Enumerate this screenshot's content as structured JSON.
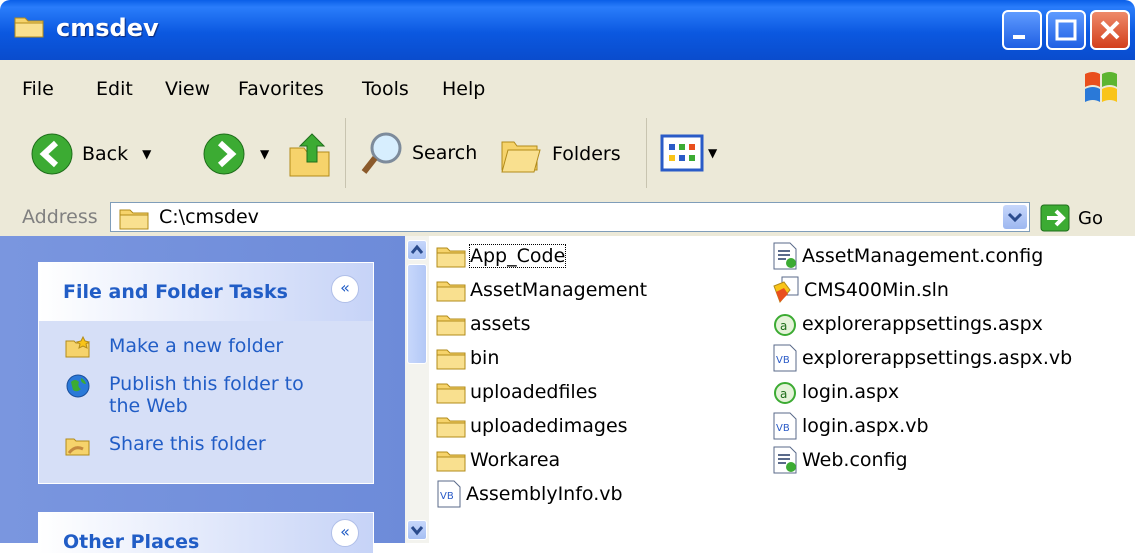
{
  "window": {
    "title": "cmsdev",
    "min_label": "",
    "max_label": "",
    "close_label": ""
  },
  "menu": [
    "File",
    "Edit",
    "View",
    "Favorites",
    "Tools",
    "Help"
  ],
  "toolbar": {
    "back": "Back",
    "search": "Search",
    "folders": "Folders"
  },
  "address": {
    "label": "Address",
    "path": "C:\\cmsdev",
    "go": "Go"
  },
  "tasks": {
    "title": "File and Folder Tasks",
    "items": [
      "Make a new folder",
      "Publish this folder to the Web",
      "Share this folder"
    ]
  },
  "other_places": {
    "title": "Other Places"
  },
  "files": {
    "col1": [
      "App_Code",
      "AssetManagement",
      "assets",
      "bin",
      "uploadedfiles",
      "uploadedimages",
      "Workarea",
      "AssemblyInfo.vb"
    ],
    "col2": [
      "AssetManagement.config",
      "CMS400Min.sln",
      "explorerappsettings.aspx",
      "explorerappsettings.aspx.vb",
      "login.aspx",
      "login.aspx.vb",
      "Web.config"
    ]
  },
  "colors": {
    "title_blue": "#0a4ccd",
    "chrome": "#ece9d8",
    "task_pane": "#6d8bd9",
    "link_blue": "#215dc6"
  }
}
